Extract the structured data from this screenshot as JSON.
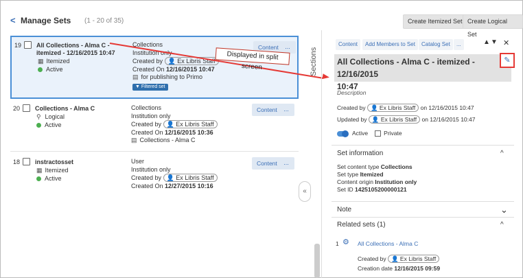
{
  "header": {
    "back": "<",
    "title": "Manage Sets",
    "range": "(1 - 20 of 35)",
    "create_itemized": "Create Itemized Set",
    "create_logical": "Create Logical Set"
  },
  "rows": [
    {
      "num": "19",
      "name1": "All Collections - Alma C -",
      "name2": "itemized - 12/16/2015 10:47",
      "type": "Itemized",
      "status": "Active",
      "c1": "Collections",
      "c2": "Institution only",
      "c3": "Created by",
      "c3p": "Ex Libris Staff",
      "c4": "Created On ",
      "c4b": "12/16/2015 10:47",
      "c5": "for publishing to Primo",
      "badge": "Filtered set",
      "content": "Content",
      "more": "..."
    },
    {
      "num": "20",
      "name1": "Collections - Alma C",
      "type": "Logical",
      "status": "Active",
      "c1": "Collections",
      "c2": "Institution only",
      "c3": "Created by",
      "c3p": "Ex Libris Staff",
      "c4": "Created On ",
      "c4b": "12/16/2015 10:36",
      "c5": "Collections - Alma C",
      "content": "Content",
      "more": "..."
    },
    {
      "num": "18",
      "name1": "instractosset",
      "type": "Itemized",
      "status": "Active",
      "c1": "User",
      "c2": "Institution only",
      "c3": "Created by",
      "c3p": "Ex Libris Staff",
      "c4": "Created On ",
      "c4b": "12/27/2015 10:16",
      "content": "Content",
      "more": "..."
    }
  ],
  "callout": "Displayed in split screen",
  "sections": "Sections",
  "collapse": "«",
  "panel": {
    "tabs": [
      "Content",
      "Add Members to Set",
      "Catalog Set",
      "..."
    ],
    "up": "▲",
    "down": "▼",
    "close": "✕",
    "title1": "All Collections - Alma C - itemized - 12/16/2015",
    "title2": "10:47",
    "edit": "✎",
    "description": "Description",
    "created_pre": "Created by",
    "created_user": "Ex Libris Staff",
    "created_post": "on 12/16/2015 10:47",
    "updated_pre": "Updated by",
    "updated_user": "Ex Libris Staff",
    "updated_post": "on 12/16/2015 10:47",
    "active": "Active",
    "private": "Private",
    "setinfo": "Set information",
    "info1a": "Set content type ",
    "info1b": "Collections",
    "info2a": "Set type ",
    "info2b": "Itemized",
    "info3a": "Content origin ",
    "info3b": "Institution only",
    "info4a": "Set ID ",
    "info4b": "1425105200000121",
    "note": "Note",
    "related": "Related sets (1)",
    "rel_num": "1",
    "rel_name": "All Collections - Alma C",
    "rel_created": "Created by",
    "rel_user": "Ex Libris Staff",
    "rel_date_a": "Creation date ",
    "rel_date_b": "12/16/2015 09:59",
    "caret_up": "^",
    "caret_down": "⌄"
  },
  "colors": {
    "accent": "#3b6fb6",
    "annotation": "#e53935",
    "active": "#4caf50"
  }
}
